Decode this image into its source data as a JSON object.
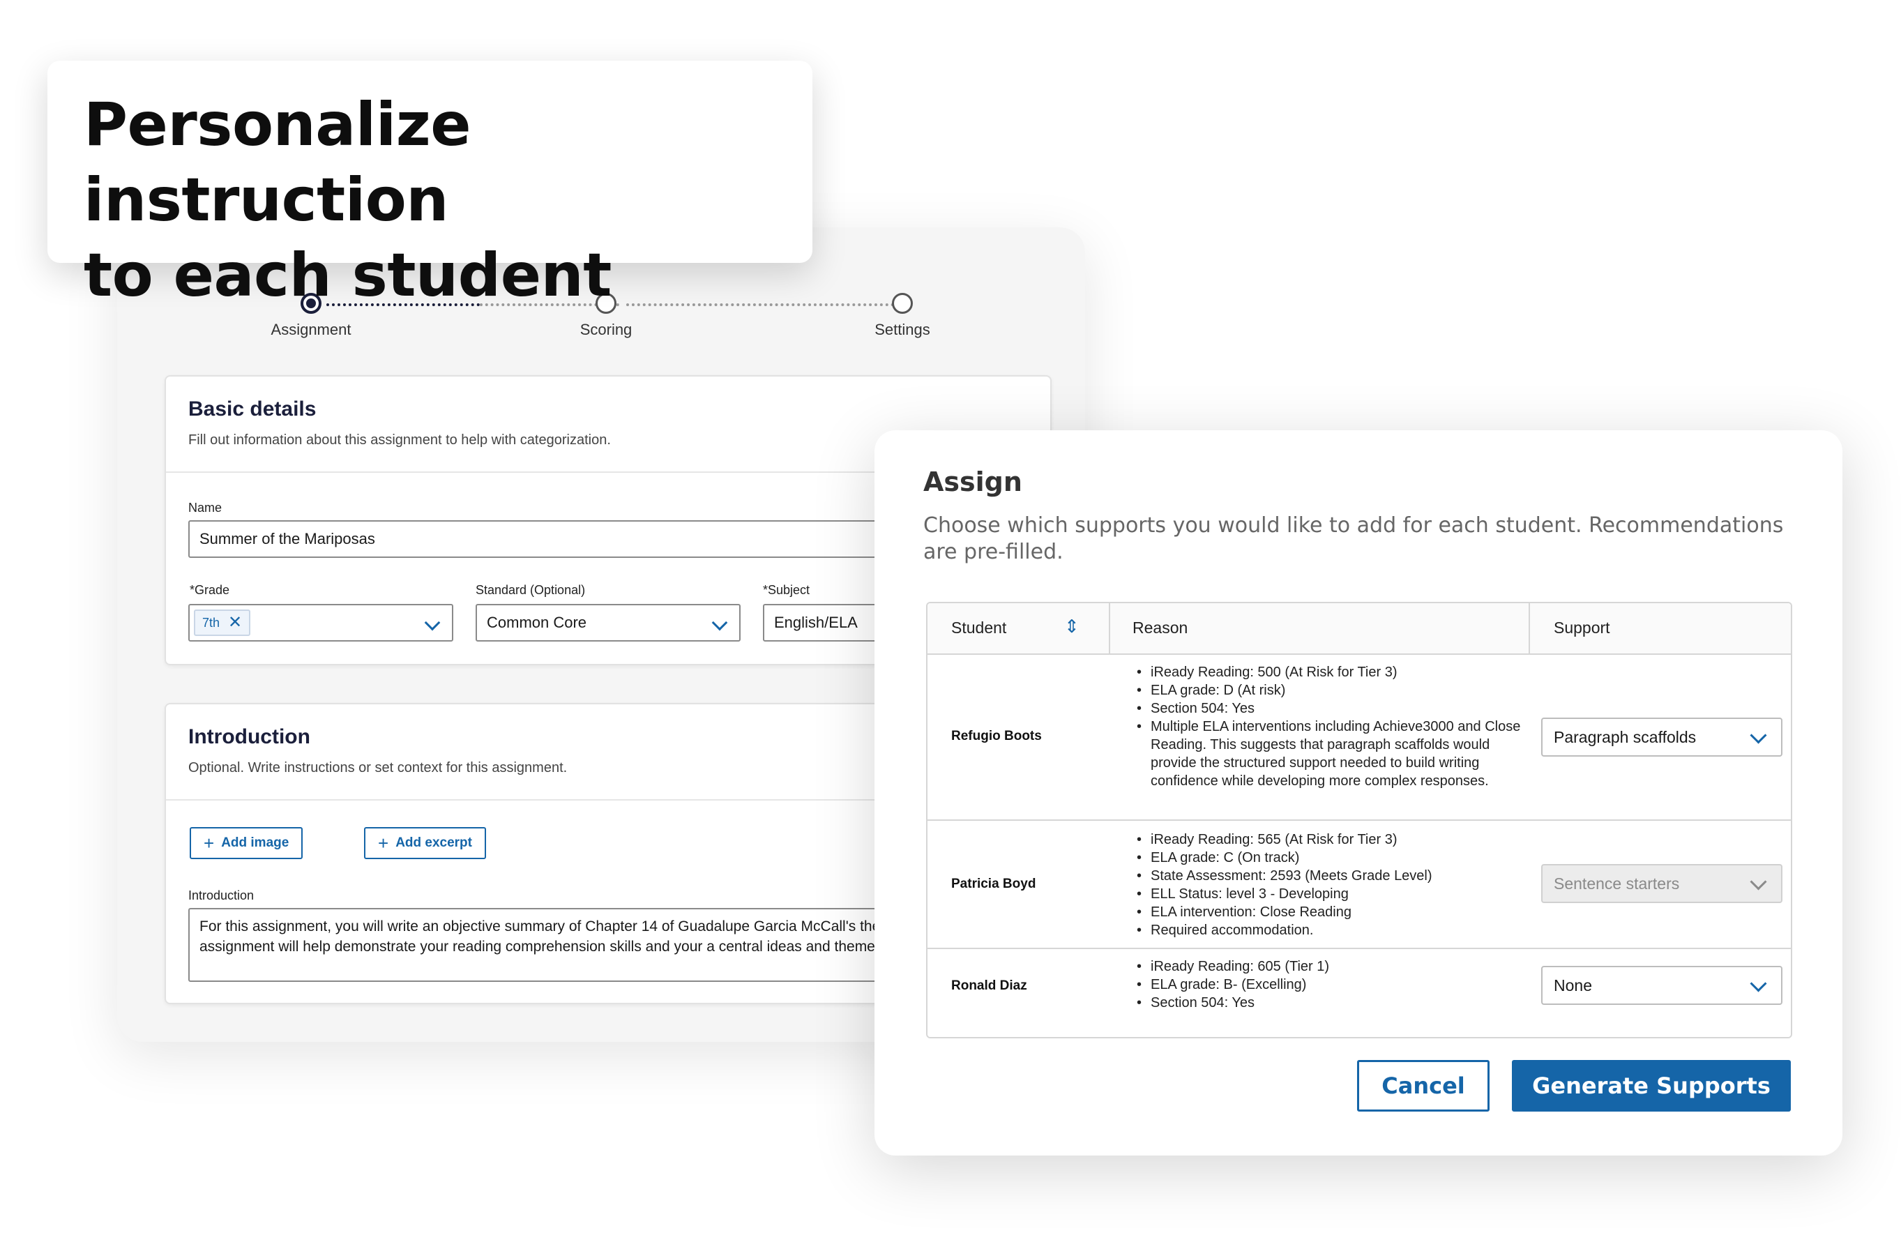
{
  "headline": "Personalize instruction\nto each student",
  "stepper": {
    "steps": [
      {
        "label": "Assignment",
        "state": "active"
      },
      {
        "label": "Scoring",
        "state": "upcoming"
      },
      {
        "label": "Settings",
        "state": "upcoming"
      }
    ]
  },
  "basic_details": {
    "title": "Basic details",
    "subtitle": "Fill out information about this assignment to help with categorization.",
    "name_label": "Name",
    "name_value": "Summer of the Mariposas",
    "grade_label": "*Grade",
    "grade_chip": "7th",
    "standard_label": "Standard (Optional)",
    "standard_value": "Common Core",
    "subject_label": "*Subject",
    "subject_value": "English/ELA"
  },
  "introduction": {
    "title": "Introduction",
    "subtitle": "Optional. Write instructions or set context for this assignment.",
    "add_image": "Add image",
    "add_excerpt": "Add excerpt",
    "field_label": "Introduction",
    "text": "For this assignment, you will write an objective summary of Chapter 14 of Guadalupe Garcia McCall's the Mariposas.\" This assignment will help demonstrate your reading comprehension skills and your a central ideas and themes in literature."
  },
  "modal": {
    "title": "Assign",
    "description": "Choose which supports you would like to add for each student. Recommendations are pre-filled.",
    "columns": {
      "student": "Student",
      "reason": "Reason",
      "support": "Support"
    },
    "rows": [
      {
        "student": "Refugio Boots",
        "reasons": [
          "iReady Reading: 500 (At Risk for Tier 3)",
          "ELA grade: D (At risk)",
          "Section 504: Yes",
          "Multiple ELA interventions including Achieve3000 and Close Reading. This suggests that paragraph scaffolds would provide the structured support needed to build writing confidence while developing more complex responses."
        ],
        "support": "Paragraph scaffolds",
        "disabled": false
      },
      {
        "student": "Patricia Boyd",
        "reasons": [
          "iReady Reading: 565 (At Risk for Tier 3)",
          "ELA grade: C (On track)",
          "State Assessment: 2593 (Meets Grade Level)",
          "ELL Status: level 3 - Developing",
          "ELA intervention: Close Reading",
          "Required accommodation."
        ],
        "support": "Sentence starters",
        "disabled": true
      },
      {
        "student": "Ronald Diaz",
        "reasons": [
          "iReady Reading: 605 (Tier 1)",
          "ELA grade: B- (Excelling)",
          "Section 504: Yes"
        ],
        "support": "None",
        "disabled": false
      }
    ],
    "cancel": "Cancel",
    "generate": "Generate Supports"
  },
  "colors": {
    "accent": "#1565a8",
    "navy": "#1b1f3b"
  }
}
